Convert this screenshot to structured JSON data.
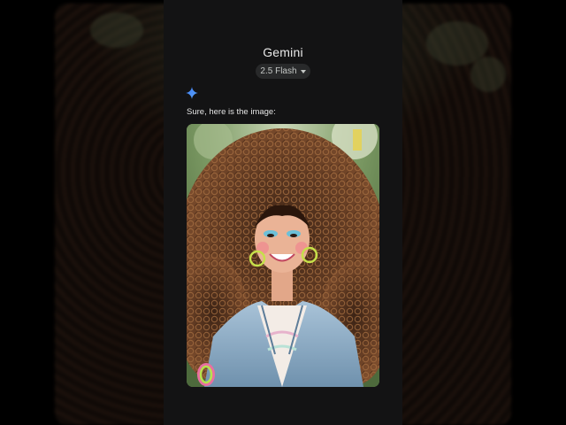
{
  "app": {
    "title": "Gemini",
    "model": "2.5 Flash"
  },
  "response": {
    "text": "Sure, here is the image:",
    "image_subject": "smiling woman with voluminous curly hair, hoop earrings and denim jacket"
  },
  "colors": {
    "panel_bg": "#131314",
    "chip_bg": "#28292a",
    "sparkle_blue": "#4a8cf7",
    "text": "#e3e3e3"
  },
  "icons": {
    "sparkle": "gemini-sparkle-icon",
    "dropdown": "chevron-down-icon"
  }
}
